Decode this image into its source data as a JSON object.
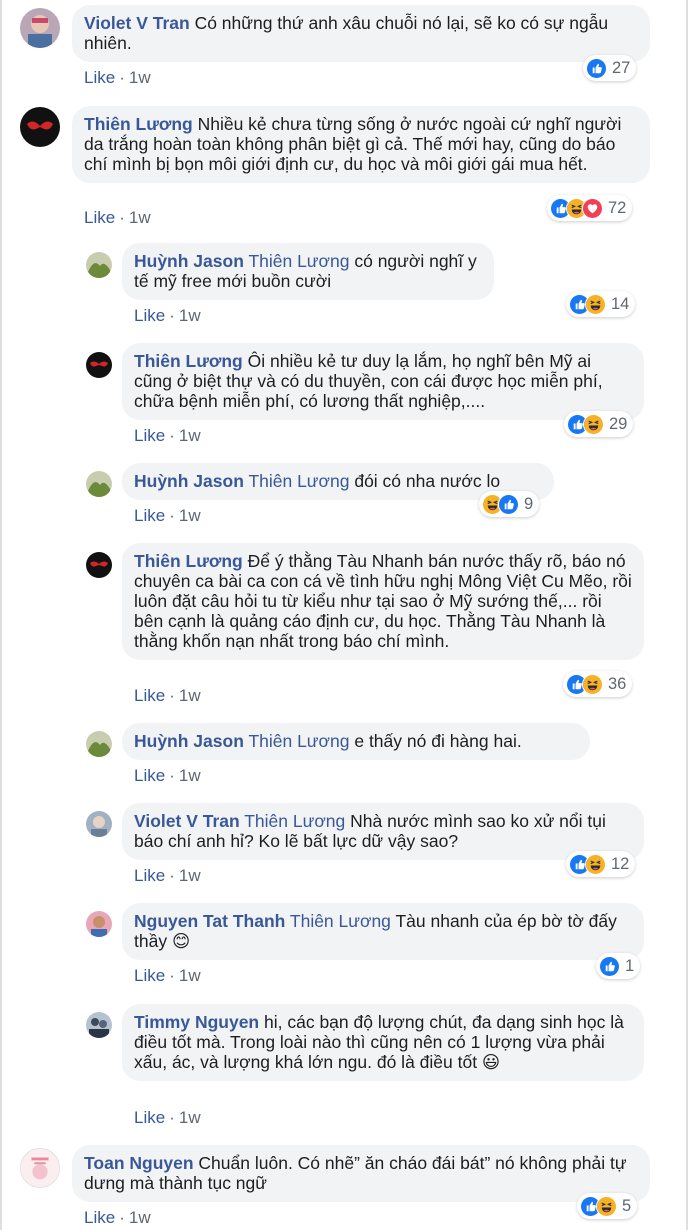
{
  "meta": {
    "like_label": "Like",
    "separator": "·"
  },
  "colors": {
    "link": "#385898",
    "bubble": "#f2f3f5",
    "like_blue": "#1877f2",
    "haha_yellow": "#f7b125",
    "love_red": "#f33e58"
  },
  "comments": [
    {
      "author": "Violet V Tran",
      "tag": "",
      "text": "Có những thứ anh xâu chuỗi nó lại, sẽ ko có sự ngẫu nhiên.",
      "time": "1w",
      "reactions": [
        "like"
      ],
      "count": "27",
      "avatar": "violet"
    },
    {
      "author": "Thiên Lương",
      "tag": "",
      "text": "Nhiều kẻ chưa từng sống ở nước ngoài cứ nghĩ người da trắng hoàn toàn không phân biệt gì cả. Thế mới hay, cũng do báo chí mình bị bọn môi giới định cư, du học và môi giới gái mua hết.",
      "time": "1w",
      "reactions": [
        "like",
        "haha",
        "love"
      ],
      "count": "72",
      "avatar": "thien"
    },
    {
      "author": "Huỳnh Jason",
      "tag": "Thiên Lương",
      "text": "có người nghĩ y tế mỹ free mới buồn cười",
      "time": "1w",
      "reactions": [
        "like",
        "haha"
      ],
      "count": "14",
      "avatar": "huynh"
    },
    {
      "author": "Thiên Lương",
      "tag": "",
      "text": "Ôi nhiều kẻ tư duy lạ lắm, họ nghĩ bên Mỹ ai cũng ở biệt thự và có du thuyền, con cái được học miễn phí, chữa bệnh miễn phí, có lương thất nghiệp,....",
      "time": "1w",
      "reactions": [
        "like",
        "haha"
      ],
      "count": "29",
      "avatar": "thien"
    },
    {
      "author": "Huỳnh Jason",
      "tag": "Thiên Lương",
      "text": "đói có nha nước lo",
      "time": "1w",
      "reactions": [
        "haha",
        "like"
      ],
      "count": "9",
      "avatar": "huynh"
    },
    {
      "author": "Thiên Lương",
      "tag": "",
      "text": "Để ý thằng Tàu Nhanh bán nước thấy rõ, báo nó chuyên ca bài ca con cá về tình hữu nghị Mông Việt Cu Mẽo, rồi luôn đặt câu hỏi tu từ kiểu như tại sao ở Mỹ sướng thế,... rồi bên cạnh là quảng cáo định cư, du học. Thằng Tàu Nhanh là thằng khốn nạn nhất trong báo chí mình.",
      "time": "1w",
      "reactions": [
        "like",
        "haha"
      ],
      "count": "36",
      "avatar": "thien"
    },
    {
      "author": "Huỳnh Jason",
      "tag": "Thiên Lương",
      "text": "e thấy nó đi hàng hai.",
      "time": "1w",
      "reactions": [],
      "count": "",
      "avatar": "huynh"
    },
    {
      "author": "Violet V Tran",
      "tag": "Thiên Lương",
      "text": "Nhà nước mình sao ko xử nổi tụi báo chí anh hỉ? Ko lẽ bất lực dữ vậy sao?",
      "time": "1w",
      "reactions": [
        "like",
        "haha"
      ],
      "count": "12",
      "avatar": "violet2"
    },
    {
      "author": "Nguyen Tat Thanh",
      "tag": "Thiên Lương",
      "text": "Tàu nhanh của ép bờ tờ đấy thầy 😊",
      "time": "1w",
      "reactions": [
        "like"
      ],
      "count": "1",
      "avatar": "nguyen"
    },
    {
      "author": "Timmy Nguyen",
      "tag": "",
      "text": "hi, các bạn độ lượng chút, đa dạng sinh học là điều tốt mà. Trong loài nào thì cũng nên có 1 lượng vừa phải xấu, ác, và lượng khá lớn ngu. đó là điều tốt 😃",
      "time": "1w",
      "reactions": [],
      "count": "",
      "avatar": "timmy"
    },
    {
      "author": "Toan Nguyen",
      "tag": "",
      "text": "Chuẩn luôn. Có nhẽ” ăn cháo đái bát” nó không phải tự dưng mà thành tục ngữ",
      "time": "1w",
      "reactions": [
        "like",
        "haha"
      ],
      "count": "5",
      "avatar": "toan"
    }
  ]
}
